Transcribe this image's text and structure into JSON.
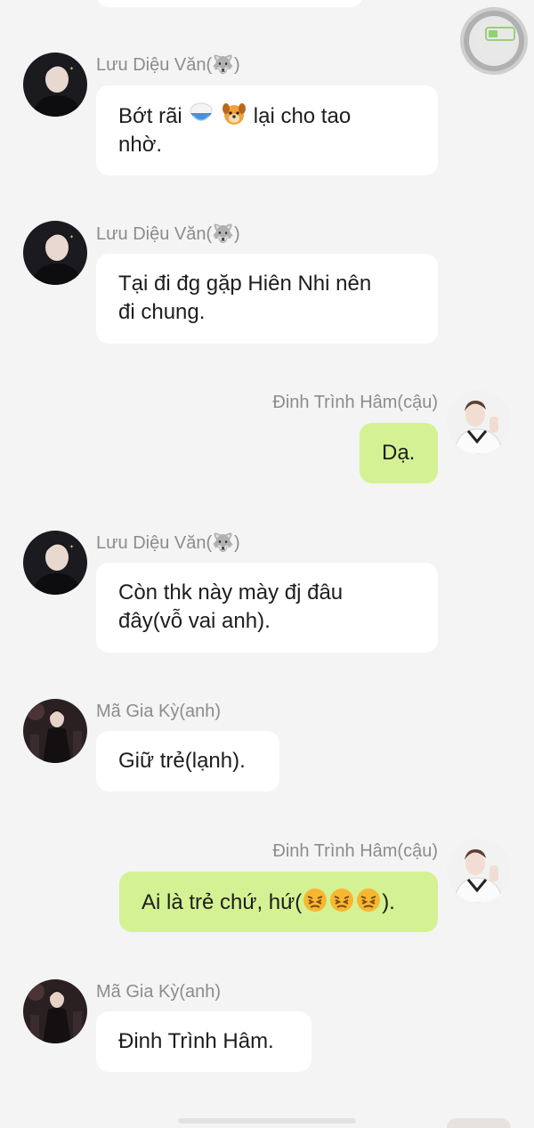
{
  "colors": {
    "background": "#f4f4f4",
    "incoming_bubble": "#ffffff",
    "outgoing_bubble": "#d4f293",
    "name_text": "#8c8c8c",
    "message_text": "#1d1d1d"
  },
  "messages": [
    {
      "sender": "Lưu Diệu Văn(🐺)",
      "side": "left",
      "avatar_icon": "dark-suit-boy-avatar",
      "text_parts": [
        "Bớt rãi ",
        "rice-icon",
        " ",
        "dog-icon",
        " lại cho tao",
        "nhờ."
      ]
    },
    {
      "sender": "Lưu Diệu Văn(🐺)",
      "side": "left",
      "avatar_icon": "dark-suit-boy-avatar",
      "text_lines": [
        "Tại đi đg gặp Hiên Nhi nên",
        "đi chung."
      ]
    },
    {
      "sender": "Đinh Trình Hâm(cậu)",
      "side": "right",
      "avatar_icon": "sweater-boy-avatar",
      "text_lines": [
        "Dạ."
      ]
    },
    {
      "sender": "Lưu Diệu Văn(🐺)",
      "side": "left",
      "avatar_icon": "dark-suit-boy-avatar",
      "text_lines": [
        "Còn thk này mày đj đâu",
        "đây(vỗ vai anh)."
      ]
    },
    {
      "sender": "Mã Gia Kỳ(anh)",
      "side": "left",
      "avatar_icon": "stage-boy-avatar",
      "text_lines": [
        "Giữ trẻ(lạnh)."
      ]
    },
    {
      "sender": "Đinh Trình Hâm(cậu)",
      "side": "right",
      "avatar_icon": "sweater-boy-avatar",
      "text_parts": [
        "Ai là trẻ chứ, hứ(",
        "angry-face-icon",
        "angry-face-icon",
        "angry-face-icon",
        ")."
      ]
    },
    {
      "sender": "Mã Gia Kỳ(anh)",
      "side": "left",
      "avatar_icon": "stage-boy-avatar",
      "text_lines": [
        "Đinh Trình Hâm."
      ]
    }
  ],
  "m": {
    "m0_name": "Lưu Diệu Văn(🐺)",
    "m0_a": "Bớt rãi ",
    "m0_b": " lại cho tao",
    "m0_c": "nhờ.",
    "m1_name": "Lưu Diệu Văn(🐺)",
    "m1_l1": "Tại đi đg gặp Hiên Nhi nên",
    "m1_l2": "đi chung.",
    "m2_name": "Đinh Trình Hâm(cậu)",
    "m2_l1": "Dạ.",
    "m3_name": "Lưu Diệu Văn(🐺)",
    "m3_l1": "Còn thk này mày đj đâu",
    "m3_l2": "đây(vỗ vai anh).",
    "m4_name": "Mã Gia Kỳ(anh)",
    "m4_l1": "Giữ trẻ(lạnh).",
    "m5_name": "Đinh Trình Hâm(cậu)",
    "m5_a": "Ai là trẻ chứ, hứ(",
    "m5_b": ").",
    "m6_name": "Mã Gia Kỳ(anh)",
    "m6_l1": "Đinh Trình Hâm."
  }
}
